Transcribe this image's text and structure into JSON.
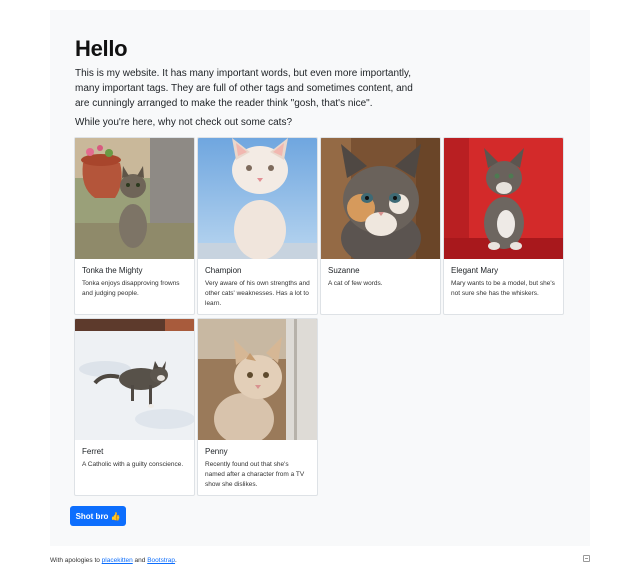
{
  "hero": {
    "title": "Hello",
    "text": "This is my website. It has many important words, but even more importantly, many important tags. They are full of other tags and sometimes content, and are cunningly arranged to make the reader think \"gosh, that's nice\".",
    "prompt": "While you're here, why not check out some cats?"
  },
  "cats": [
    {
      "name": "Tonka the Mighty",
      "description": "Tonka enjoys disapproving frowns and judging people."
    },
    {
      "name": "Champion",
      "description": "Very aware of his own strengths and other cats' weaknesses. Has a lot to learn."
    },
    {
      "name": "Suzanne",
      "description": "A cat of few words."
    },
    {
      "name": "Elegant Mary",
      "description": "Mary wants to be a model, but she's not sure she has the whiskers."
    },
    {
      "name": "Ferret",
      "description": "A Catholic with a guilty conscience."
    },
    {
      "name": "Penny",
      "description": "Recently found out that she's named after a character from a TV show she dislikes."
    }
  ],
  "button": {
    "label": "Shot bro",
    "icon": "thumbs-up-icon",
    "color": "#0d6efd"
  },
  "footer": {
    "prefix": "With apologies to ",
    "link1": "placekitten",
    "middle": " and ",
    "link2": "Bootstrap",
    "suffix": "."
  }
}
